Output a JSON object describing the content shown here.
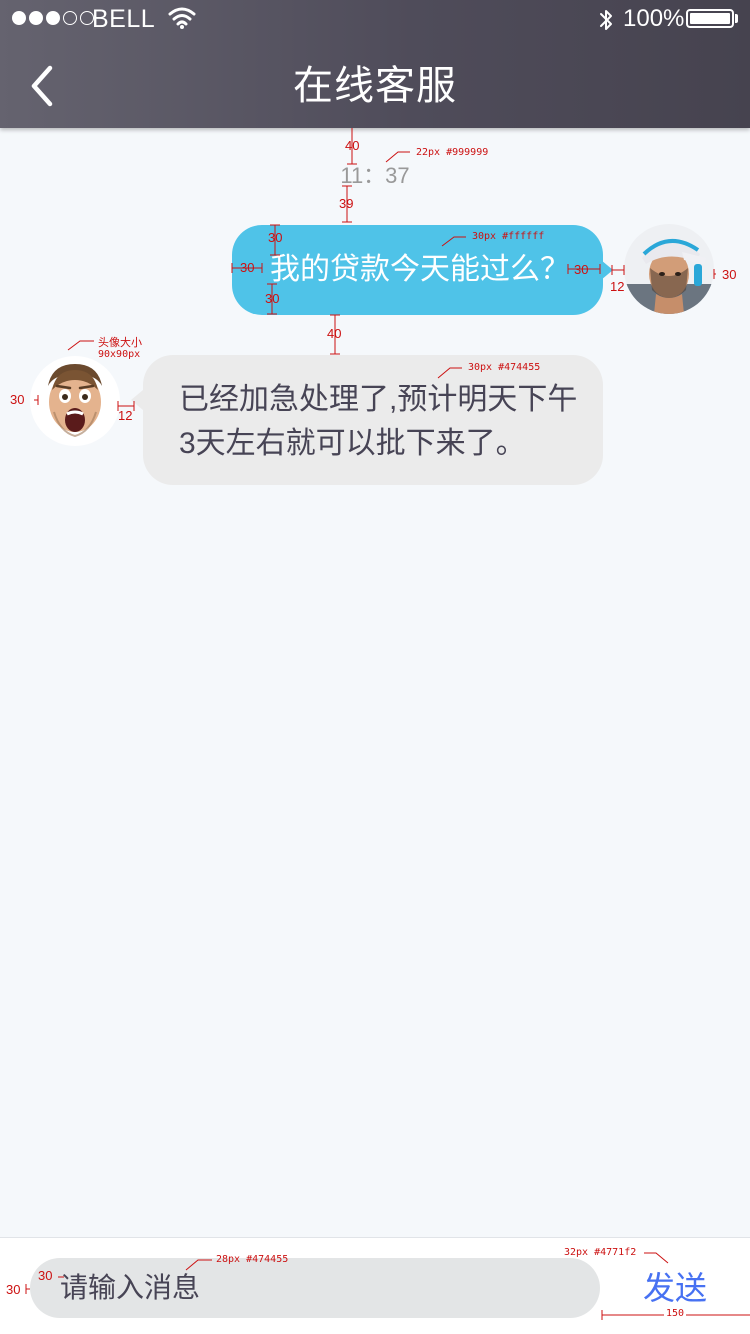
{
  "status_bar": {
    "carrier": "BELL",
    "signal_bars_filled": 3,
    "signal_bars_total": 5,
    "battery_percent": "100%",
    "icons": [
      "wifi-icon",
      "bluetooth-icon",
      "battery-icon"
    ]
  },
  "header": {
    "title": "在线客服",
    "back_icon": "chevron-left-icon",
    "background": "#4f4c5a"
  },
  "chat": {
    "timestamp": "11：37",
    "messages": [
      {
        "sender": "user",
        "text": "我的贷款今天能过么？",
        "bubble_color": "#4fc3e8",
        "text_color": "#ffffff"
      },
      {
        "sender": "agent",
        "lines": [
          "已经加急处理了,预计明天下午",
          "3天左右就可以批下来了。"
        ],
        "bubble_color": "#ebebeb",
        "text_color": "#474455"
      }
    ]
  },
  "annotations": {
    "time_gap_top": "40",
    "time_spec": "22px #999999",
    "time_gap_bottom": "39",
    "out_spec": "30px #ffffff",
    "out_pad_top": "30",
    "out_pad_left": "30",
    "out_pad_bottom": "30",
    "out_pad_right": "30",
    "avatar_gap_right": "12",
    "avatar_margin_right": "30",
    "msg_gap": "40",
    "avatar_size_label": "头像大小",
    "avatar_size_value": "90x90px",
    "avatar_margin_left": "30",
    "avatar_gap_left": "12",
    "in_spec": "30px #474455",
    "input_margin_left": "30",
    "input_pad_left": "30",
    "input_spec": "28px #474455",
    "send_spec": "32px #4771f2",
    "send_width": "150"
  },
  "composer": {
    "placeholder": "请输入消息",
    "send_label": "发送",
    "send_color": "#4771f2"
  }
}
